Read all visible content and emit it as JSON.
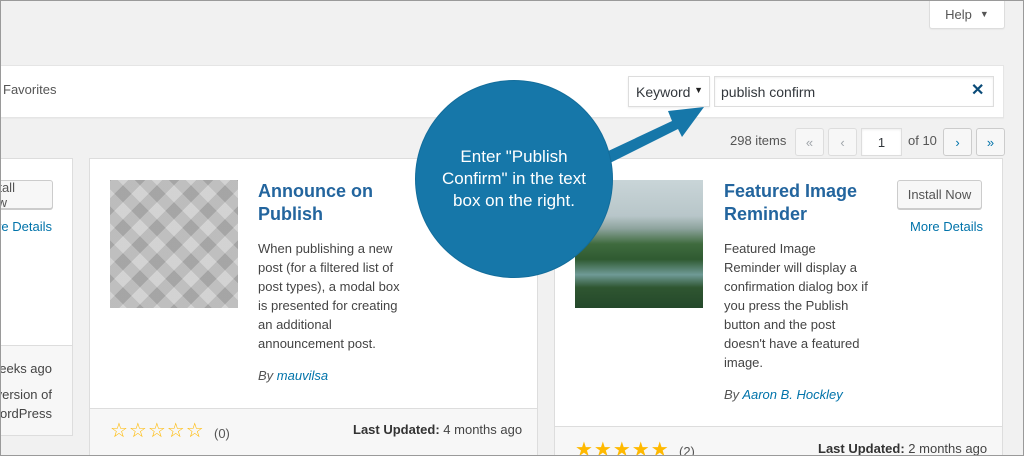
{
  "help": {
    "label": "Help"
  },
  "filter": {
    "favorites_label": "Favorites",
    "search_type": "Keyword",
    "search_value": "publish confirm"
  },
  "pagination": {
    "items": "298 items",
    "first": "«",
    "prev": "‹",
    "current_page": "1",
    "of_pages": "of 10",
    "next": "›",
    "last": "»"
  },
  "left_card": {
    "install_label": "Install Now",
    "details_label": "More Details",
    "updated_text": "weeks ago",
    "compat_line1": "version of",
    "compat_line2": "ordPress"
  },
  "plugins": [
    {
      "title": "Announce on Publish",
      "description": "When publishing a new post (for a filtered list of post types), a modal box is presented for creating an additional announcement post.",
      "by_prefix": "By",
      "author": "mauvilsa",
      "stars": "☆☆☆☆☆",
      "rating_count": "(0)",
      "last_updated_label": "Last Updated:",
      "last_updated_value": "4 months ago"
    },
    {
      "title": "Featured Image Reminder",
      "install_label": "Install Now",
      "details_label": "More Details",
      "description": "Featured Image Reminder will display a confirmation dialog box if you press the Publish button and the post doesn't have a featured image.",
      "by_prefix": "By",
      "author": "Aaron B. Hockley",
      "stars": "★★★★★",
      "rating_count": "(2)",
      "last_updated_label": "Last Updated:",
      "last_updated_value": "2 months ago"
    }
  ],
  "callout": {
    "text": "Enter \"Publish Confirm\" in the text box on the right."
  },
  "colors": {
    "accent": "#0073aa",
    "callout": "#1677a9",
    "star": "#ffb900"
  }
}
